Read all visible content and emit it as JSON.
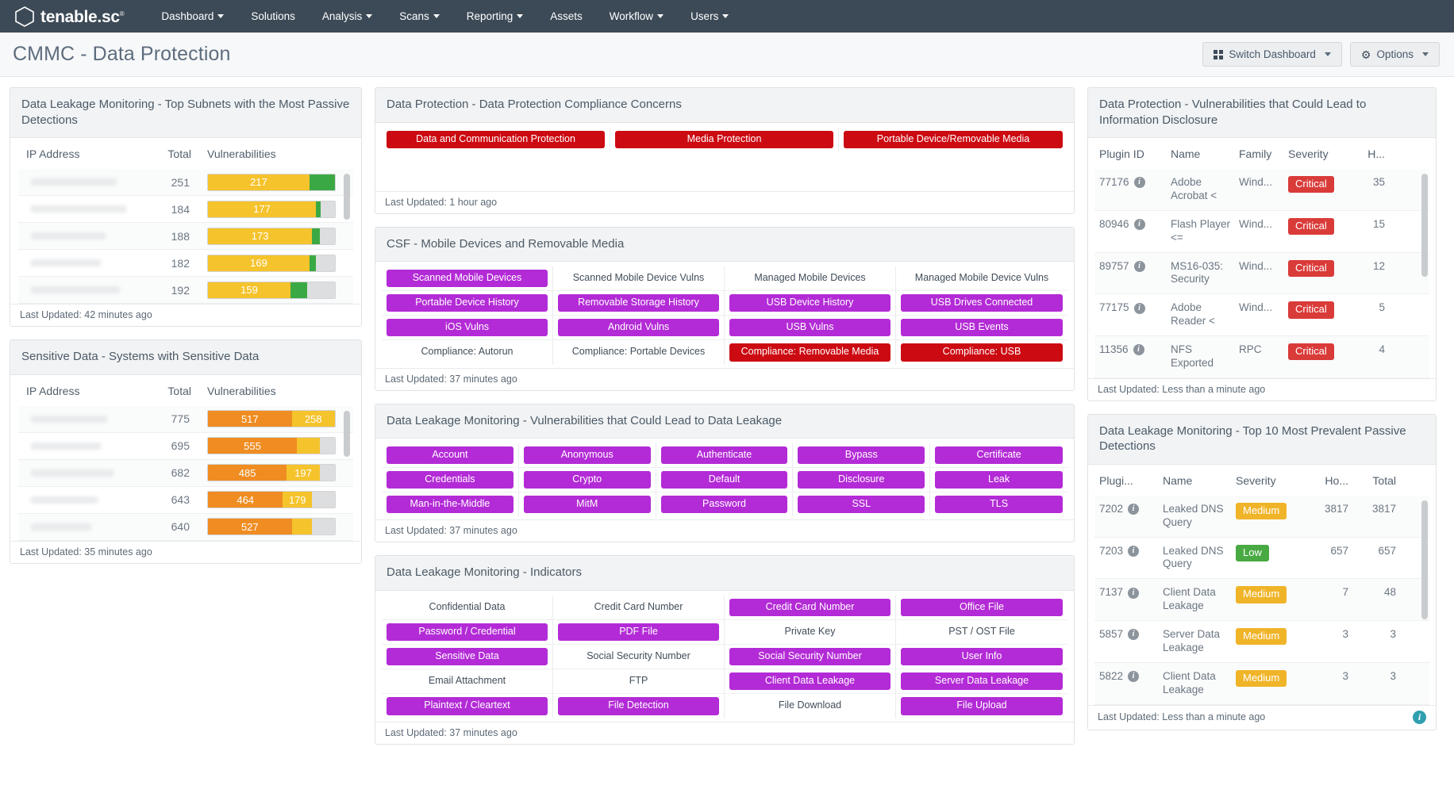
{
  "navbar": {
    "brand": "tenable.sc",
    "brand_tm": "®",
    "logo_icon": "hexagon-logo-icon",
    "items": [
      {
        "label": "Dashboard",
        "caret": true
      },
      {
        "label": "Solutions",
        "caret": false
      },
      {
        "label": "Analysis",
        "caret": true
      },
      {
        "label": "Scans",
        "caret": true
      },
      {
        "label": "Reporting",
        "caret": true
      },
      {
        "label": "Assets",
        "caret": false
      },
      {
        "label": "Workflow",
        "caret": true
      },
      {
        "label": "Users",
        "caret": true
      }
    ]
  },
  "header": {
    "title": "CMMC - Data Protection",
    "switch_dashboard_label": "Switch Dashboard",
    "options_label": "Options"
  },
  "colors": {
    "navbar_bg": "#3c4a57",
    "purple": "#b32bd6",
    "red": "#cc0a12",
    "critical": "#d93b39",
    "medium": "#f0b429",
    "low": "#49a942",
    "bar_yellow": "#f5c32c",
    "bar_green": "#3ba943",
    "bar_orange": "#ef8d22",
    "info_teal": "#2f9fb0"
  },
  "left_column": {
    "subnets_widget": {
      "title": "Data Leakage Monitoring - Top Subnets with the Most Passive Detections",
      "columns": {
        "ip": "IP Address",
        "total": "Total",
        "vulns": "Vulnerabilities"
      },
      "rows": [
        {
          "ip_redacted": true,
          "total": "251",
          "segments": [
            {
              "label": "217",
              "pct": 80,
              "color": "yellow"
            },
            {
              "label": "",
              "pct": 20,
              "color": "green"
            }
          ]
        },
        {
          "ip_redacted": true,
          "total": "184",
          "segments": [
            {
              "label": "177",
              "pct": 85,
              "color": "yellow"
            },
            {
              "label": "",
              "pct": 4,
              "color": "green"
            }
          ]
        },
        {
          "ip_redacted": true,
          "total": "188",
          "segments": [
            {
              "label": "173",
              "pct": 82,
              "color": "yellow"
            },
            {
              "label": "",
              "pct": 6,
              "color": "green"
            }
          ]
        },
        {
          "ip_redacted": true,
          "total": "182",
          "segments": [
            {
              "label": "169",
              "pct": 80,
              "color": "yellow"
            },
            {
              "label": "",
              "pct": 5,
              "color": "green"
            }
          ]
        },
        {
          "ip_redacted": true,
          "total": "192",
          "segments": [
            {
              "label": "159",
              "pct": 65,
              "color": "yellow"
            },
            {
              "label": "",
              "pct": 13,
              "color": "green"
            }
          ]
        }
      ],
      "footer": "Last Updated: 42 minutes ago"
    },
    "sensitive_widget": {
      "title": "Sensitive Data - Systems with Sensitive Data",
      "columns": {
        "ip": "IP Address",
        "total": "Total",
        "vulns": "Vulnerabilities"
      },
      "rows": [
        {
          "ip_redacted": true,
          "total": "775",
          "segments": [
            {
              "label": "517",
              "pct": 66,
              "color": "orange"
            },
            {
              "label": "258",
              "pct": 34,
              "color": "yellow"
            }
          ]
        },
        {
          "ip_redacted": true,
          "total": "695",
          "segments": [
            {
              "label": "555",
              "pct": 70,
              "color": "orange"
            },
            {
              "label": "",
              "pct": 18,
              "color": "yellow"
            }
          ]
        },
        {
          "ip_redacted": true,
          "total": "682",
          "segments": [
            {
              "label": "485",
              "pct": 62,
              "color": "orange"
            },
            {
              "label": "197",
              "pct": 26,
              "color": "yellow"
            }
          ]
        },
        {
          "ip_redacted": true,
          "total": "643",
          "segments": [
            {
              "label": "464",
              "pct": 59,
              "color": "orange"
            },
            {
              "label": "179",
              "pct": 23,
              "color": "yellow"
            }
          ]
        },
        {
          "ip_redacted": true,
          "total": "640",
          "segments": [
            {
              "label": "527",
              "pct": 66,
              "color": "orange"
            },
            {
              "label": "",
              "pct": 16,
              "color": "yellow"
            }
          ]
        }
      ],
      "footer": "Last Updated: 35 minutes ago"
    }
  },
  "middle_column": {
    "compliance_concerns": {
      "title": "Data Protection - Data Protection Compliance Concerns",
      "rows": [
        [
          {
            "label": "Data and Communication Protection",
            "style": "red"
          },
          {
            "label": "Media Protection",
            "style": "red"
          },
          {
            "label": "Portable Device/Removable Media",
            "style": "red"
          }
        ]
      ],
      "footer": "Last Updated: 1 hour ago"
    },
    "mobile_devices": {
      "title": "CSF - Mobile Devices and Removable Media",
      "rows": [
        [
          {
            "label": "Scanned Mobile Devices",
            "style": "purple"
          },
          {
            "label": "Scanned Mobile Device Vulns",
            "style": "plain"
          },
          {
            "label": "Managed Mobile Devices",
            "style": "plain"
          },
          {
            "label": "Managed Mobile Device Vulns",
            "style": "plain"
          }
        ],
        [
          {
            "label": "Portable Device History",
            "style": "purple"
          },
          {
            "label": "Removable Storage History",
            "style": "purple"
          },
          {
            "label": "USB Device History",
            "style": "purple"
          },
          {
            "label": "USB Drives Connected",
            "style": "purple"
          }
        ],
        [
          {
            "label": "iOS Vulns",
            "style": "purple"
          },
          {
            "label": "Android Vulns",
            "style": "purple"
          },
          {
            "label": "USB Vulns",
            "style": "purple"
          },
          {
            "label": "USB Events",
            "style": "purple"
          }
        ],
        [
          {
            "label": "Compliance: Autorun",
            "style": "plain"
          },
          {
            "label": "Compliance: Portable Devices",
            "style": "plain"
          },
          {
            "label": "Compliance: Removable Media",
            "style": "red"
          },
          {
            "label": "Compliance: USB",
            "style": "red"
          }
        ]
      ],
      "footer": "Last Updated: 37 minutes ago"
    },
    "leakage_vulns": {
      "title": "Data Leakage Monitoring - Vulnerabilities that Could Lead to Data Leakage",
      "rows": [
        [
          {
            "label": "Account",
            "style": "purple"
          },
          {
            "label": "Anonymous",
            "style": "purple"
          },
          {
            "label": "Authenticate",
            "style": "purple"
          },
          {
            "label": "Bypass",
            "style": "purple"
          },
          {
            "label": "Certificate",
            "style": "purple"
          }
        ],
        [
          {
            "label": "Credentials",
            "style": "purple"
          },
          {
            "label": "Crypto",
            "style": "purple"
          },
          {
            "label": "Default",
            "style": "purple"
          },
          {
            "label": "Disclosure",
            "style": "purple"
          },
          {
            "label": "Leak",
            "style": "purple"
          }
        ],
        [
          {
            "label": "Man-in-the-Middle",
            "style": "purple"
          },
          {
            "label": "MitM",
            "style": "purple"
          },
          {
            "label": "Password",
            "style": "purple"
          },
          {
            "label": "SSL",
            "style": "purple"
          },
          {
            "label": "TLS",
            "style": "purple"
          }
        ]
      ],
      "footer": "Last Updated: 37 minutes ago"
    },
    "indicators": {
      "title": "Data Leakage Monitoring - Indicators",
      "rows": [
        [
          {
            "label": "Confidential Data",
            "style": "plain"
          },
          {
            "label": "Credit Card Number",
            "style": "plain"
          },
          {
            "label": "Credit Card Number",
            "style": "purple"
          },
          {
            "label": "Office File",
            "style": "purple"
          }
        ],
        [
          {
            "label": "Password / Credential",
            "style": "purple"
          },
          {
            "label": "PDF File",
            "style": "purple"
          },
          {
            "label": "Private Key",
            "style": "plain"
          },
          {
            "label": "PST / OST File",
            "style": "plain"
          }
        ],
        [
          {
            "label": "Sensitive Data",
            "style": "purple"
          },
          {
            "label": "Social Security Number",
            "style": "plain"
          },
          {
            "label": "Social Security Number",
            "style": "purple"
          },
          {
            "label": "User Info",
            "style": "purple"
          }
        ],
        [
          {
            "label": "Email Attachment",
            "style": "plain"
          },
          {
            "label": "FTP",
            "style": "plain"
          },
          {
            "label": "Client Data Leakage",
            "style": "purple"
          },
          {
            "label": "Server Data Leakage",
            "style": "purple"
          }
        ],
        [
          {
            "label": "Plaintext / Cleartext",
            "style": "purple"
          },
          {
            "label": "File Detection",
            "style": "purple"
          },
          {
            "label": "File Download",
            "style": "plain"
          },
          {
            "label": "File Upload",
            "style": "purple"
          }
        ]
      ],
      "footer": "Last Updated: 37 minutes ago"
    }
  },
  "right_column": {
    "info_disclosure": {
      "title": "Data Protection - Vulnerabilities that Could Lead to Information Disclosure",
      "columns": {
        "plugin_id": "Plugin ID",
        "name": "Name",
        "family": "Family",
        "severity": "Severity",
        "hosts": "H..."
      },
      "rows": [
        {
          "plugin_id": "77176",
          "name": "Adobe Acrobat <",
          "family": "Wind...",
          "severity": "Critical",
          "severity_style": "critical",
          "hosts": "35"
        },
        {
          "plugin_id": "80946",
          "name": "Flash Player <=",
          "family": "Wind...",
          "severity": "Critical",
          "severity_style": "critical",
          "hosts": "15"
        },
        {
          "plugin_id": "89757",
          "name": "MS16-035: Security",
          "family": "Wind...",
          "severity": "Critical",
          "severity_style": "critical",
          "hosts": "12"
        },
        {
          "plugin_id": "77175",
          "name": "Adobe Reader <",
          "family": "Wind...",
          "severity": "Critical",
          "severity_style": "critical",
          "hosts": "5"
        },
        {
          "plugin_id": "11356",
          "name": "NFS Exported",
          "family": "RPC",
          "severity": "Critical",
          "severity_style": "critical",
          "hosts": "4"
        }
      ],
      "footer": "Last Updated: Less than a minute ago"
    },
    "prevalent_detections": {
      "title": "Data Leakage Monitoring - Top 10 Most Prevalent Passive Detections",
      "columns": {
        "plugin_id": "Plugi...",
        "name": "Name",
        "severity": "Severity",
        "hosts": "Ho...",
        "total": "Total"
      },
      "rows": [
        {
          "plugin_id": "7202",
          "name": "Leaked DNS Query",
          "severity": "Medium",
          "severity_style": "medium",
          "hosts": "3817",
          "total": "3817"
        },
        {
          "plugin_id": "7203",
          "name": "Leaked DNS Query",
          "severity": "Low",
          "severity_style": "low",
          "hosts": "657",
          "total": "657"
        },
        {
          "plugin_id": "7137",
          "name": "Client Data Leakage",
          "severity": "Medium",
          "severity_style": "medium",
          "hosts": "7",
          "total": "48"
        },
        {
          "plugin_id": "5857",
          "name": "Server Data Leakage",
          "severity": "Medium",
          "severity_style": "medium",
          "hosts": "3",
          "total": "3"
        },
        {
          "plugin_id": "5822",
          "name": "Client Data Leakage",
          "severity": "Medium",
          "severity_style": "medium",
          "hosts": "3",
          "total": "3"
        }
      ],
      "footer": "Last Updated: Less than a minute ago",
      "info_icon": "info-circle-icon"
    }
  }
}
